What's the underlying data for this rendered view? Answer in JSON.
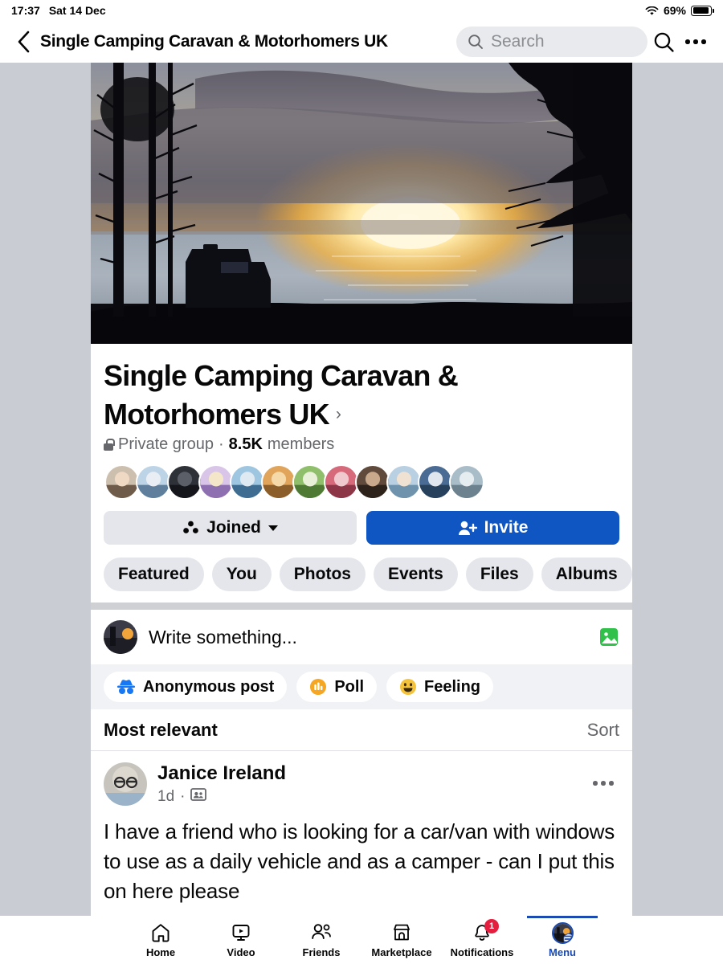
{
  "status_bar": {
    "time": "17:37",
    "date": "Sat 14 Dec",
    "battery_percent": "69%",
    "wifi_icon": "wifi-icon",
    "battery_icon": "battery-icon"
  },
  "top_bar": {
    "back_icon": "back-chevron-icon",
    "title": "Single Camping Caravan & Motorhomers UK",
    "search_placeholder": "Search",
    "search_icon": "search-icon",
    "more_icon": "more-options-icon"
  },
  "group": {
    "cover_photo_alt": "sunset-over-water-with-motorhome-cover-photo",
    "name": "Single Camping Caravan & Motorhomers UK",
    "name_chevron": "›",
    "privacy_icon": "lock-icon",
    "privacy": "Private group",
    "separator": "·",
    "member_count": "8.5K",
    "member_label": "members",
    "member_avatars_count": 12,
    "buttons": {
      "joined_label": "Joined",
      "joined_icon": "group-members-icon",
      "joined_caret": "chevron-down-icon",
      "invite_label": "Invite",
      "invite_icon": "person-add-icon"
    },
    "tabs": [
      "Featured",
      "You",
      "Photos",
      "Events",
      "Files",
      "Albums"
    ]
  },
  "composer": {
    "placeholder": "Write something...",
    "photo_icon": "photo-icon",
    "avatar": "user-avatar",
    "actions": [
      {
        "label": "Anonymous post",
        "icon": "incognito-icon",
        "color": "#1877f2"
      },
      {
        "label": "Poll",
        "icon": "poll-icon",
        "color": "#f5a623"
      },
      {
        "label": "Feeling",
        "icon": "smiley-icon",
        "color": "#f5c33b"
      }
    ]
  },
  "feed": {
    "sort_label": "Most relevant",
    "sort_button": "Sort",
    "posts": [
      {
        "author": "Janice Ireland",
        "timestamp": "1d",
        "meta_separator": "·",
        "audience_icon": "group-audience-icon",
        "more_icon": "post-more-options-icon",
        "text": "I have a friend who is looking for a car/van with windows to use as a daily vehicle and as a camper - can I put this on here please"
      }
    ]
  },
  "bottom_nav": {
    "items": [
      {
        "label": "Home",
        "icon": "home-icon",
        "active": false,
        "badge": ""
      },
      {
        "label": "Video",
        "icon": "video-icon",
        "active": false,
        "badge": ""
      },
      {
        "label": "Friends",
        "icon": "friends-icon",
        "active": false,
        "badge": ""
      },
      {
        "label": "Marketplace",
        "icon": "marketplace-icon",
        "active": false,
        "badge": ""
      },
      {
        "label": "Notifications",
        "icon": "bell-icon",
        "active": false,
        "badge": "1"
      },
      {
        "label": "Menu",
        "icon": "menu-avatar-icon",
        "active": true,
        "badge": ""
      }
    ]
  },
  "colors": {
    "page_background": "#c9ccd2",
    "accent_blue": "#0f56c3",
    "active_blue": "#1b4bb0",
    "chip_gray": "#e4e6eb",
    "text_secondary": "#65676b",
    "badge_red": "#e41e3f"
  }
}
